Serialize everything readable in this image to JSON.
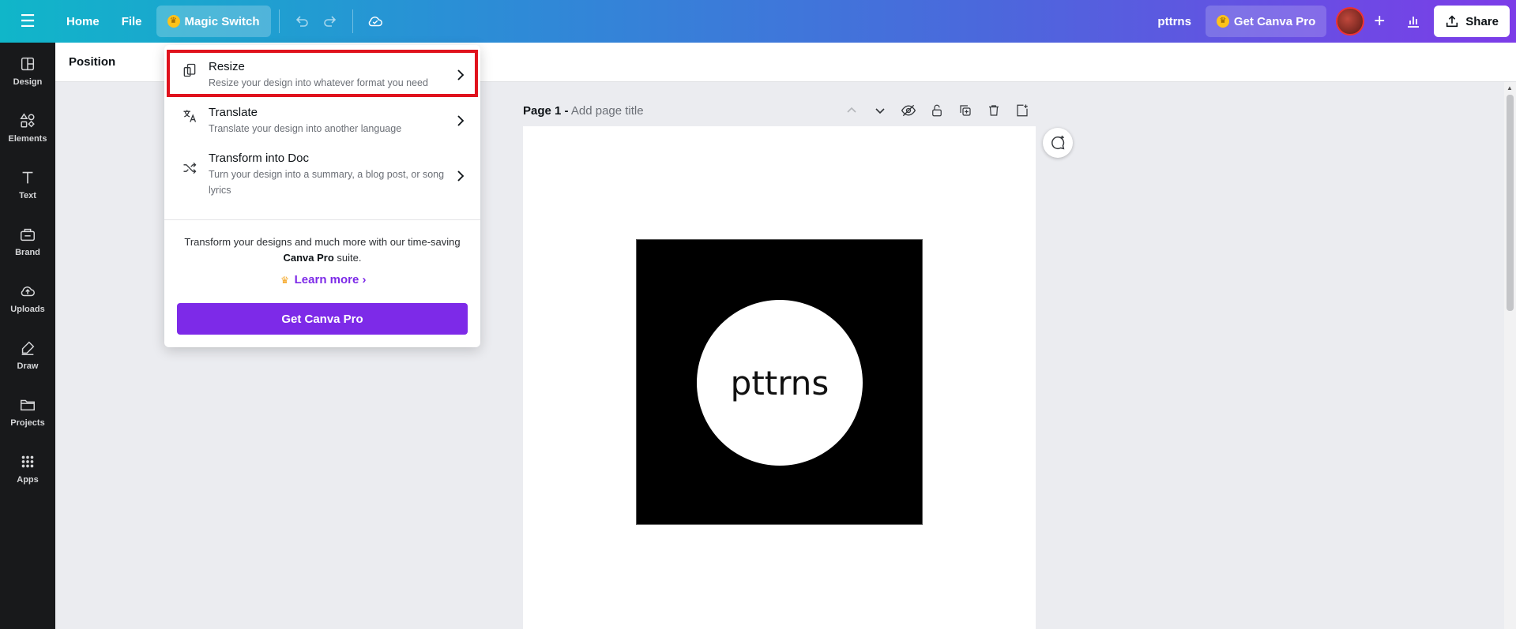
{
  "colors": {
    "accent": "#7d2ae8",
    "highlight": "#e0121d",
    "crown": "#ffc21a"
  },
  "topbar": {
    "home_label": "Home",
    "file_label": "File",
    "magic_switch_label": "Magic Switch",
    "doc_title": "pttrns",
    "get_pro_label": "Get Canva Pro",
    "share_label": "Share"
  },
  "sidebar": {
    "items": [
      {
        "label": "Design",
        "icon": "design-icon"
      },
      {
        "label": "Elements",
        "icon": "elements-icon"
      },
      {
        "label": "Text",
        "icon": "text-icon"
      },
      {
        "label": "Brand",
        "icon": "brand-icon"
      },
      {
        "label": "Uploads",
        "icon": "upload-icon"
      },
      {
        "label": "Draw",
        "icon": "draw-icon"
      },
      {
        "label": "Projects",
        "icon": "folder-icon"
      },
      {
        "label": "Apps",
        "icon": "apps-icon"
      }
    ]
  },
  "toolbar": {
    "position_label": "Position"
  },
  "page": {
    "label": "Page 1 -",
    "title_placeholder": "Add page title"
  },
  "canvas": {
    "artwork_text": "pttrns"
  },
  "menu": {
    "items": [
      {
        "title": "Resize",
        "description": "Resize your design into whatever format you need",
        "icon": "resize-icon"
      },
      {
        "title": "Translate",
        "description": "Translate your design into another language",
        "icon": "translate-icon"
      },
      {
        "title": "Transform into Doc",
        "description": "Turn your design into a summary, a blog post, or song lyrics",
        "icon": "shuffle-icon"
      }
    ],
    "promo_text_1": "Transform your designs and much more with our time-saving",
    "promo_brand": "Canva Pro",
    "promo_text_2": "suite.",
    "learn_more_label": "Learn more",
    "get_pro_label": "Get Canva Pro"
  }
}
